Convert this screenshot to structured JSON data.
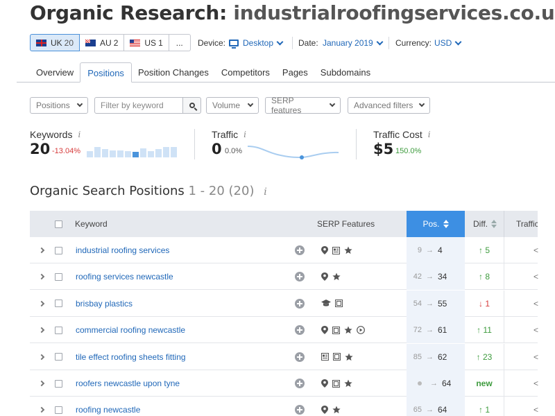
{
  "page": {
    "title_prefix": "Organic Research:",
    "title_domain": "industrialroofingservices.co.uk"
  },
  "databases": [
    {
      "code": "UK",
      "count": "20",
      "flag": "uk",
      "active": true
    },
    {
      "code": "AU",
      "count": "2",
      "flag": "au",
      "active": false
    },
    {
      "code": "US",
      "count": "1",
      "flag": "us",
      "active": false
    }
  ],
  "more_label": "...",
  "device": {
    "label": "Device:",
    "value": "Desktop"
  },
  "date": {
    "label": "Date:",
    "value": "January 2019"
  },
  "currency": {
    "label": "Currency:",
    "value": "USD"
  },
  "tabs": [
    "Overview",
    "Positions",
    "Position Changes",
    "Competitors",
    "Pages",
    "Subdomains"
  ],
  "active_tab": "Positions",
  "filters": {
    "positions": "Positions",
    "keyword_placeholder": "Filter by keyword",
    "volume": "Volume",
    "serp": "SERP features",
    "advanced": "Advanced filters"
  },
  "summary": {
    "keywords": {
      "label": "Keywords",
      "value": "20",
      "change": "-13.04%"
    },
    "traffic": {
      "label": "Traffic",
      "value": "0",
      "change": "0.0%"
    },
    "traffic_cost": {
      "label": "Traffic Cost",
      "value": "$5",
      "change": "150.0%"
    },
    "keywords_trend": [
      0.55,
      0.95,
      0.75,
      0.6,
      0.65,
      0.55,
      0.5,
      0.8,
      0.55,
      0.75,
      0.95,
      0.95
    ],
    "keywords_trend_highlight": 6
  },
  "section": {
    "title": "Organic Search Positions",
    "range": "1 - 20 (20)"
  },
  "table": {
    "columns": {
      "keyword": "Keyword",
      "serp": "SERP Features",
      "pos": "Pos.",
      "diff": "Diff.",
      "traffic": "Traffic"
    },
    "rows": [
      {
        "keyword": "industrial roofing services",
        "serp": [
          "pin-icon",
          "document-icon",
          "star-icon"
        ],
        "prev": "9",
        "pos": "4",
        "diff": "↑ 5",
        "diff_type": "up"
      },
      {
        "keyword": "roofing services newcastle",
        "serp": [
          "pin-icon",
          "star-icon"
        ],
        "prev": "42",
        "pos": "34",
        "diff": "↑ 8",
        "diff_type": "up"
      },
      {
        "keyword": "brisbay plastics",
        "serp": [
          "graduation-cap-icon",
          "image-icon"
        ],
        "prev": "54",
        "pos": "55",
        "diff": "↓ 1",
        "diff_type": "down"
      },
      {
        "keyword": "commercial roofing newcastle",
        "serp": [
          "pin-icon",
          "image-icon",
          "star-icon",
          "play-icon"
        ],
        "prev": "72",
        "pos": "61",
        "diff": "↑ 11",
        "diff_type": "up"
      },
      {
        "keyword": "tile effect roofing sheets fitting",
        "serp": [
          "document-icon",
          "image-icon",
          "star-icon"
        ],
        "prev": "85",
        "pos": "62",
        "diff": "↑ 23",
        "diff_type": "up"
      },
      {
        "keyword": "roofers newcastle upon tyne",
        "serp": [
          "pin-icon",
          "image-icon",
          "star-icon"
        ],
        "prev": "",
        "pos": "64",
        "diff": "new",
        "diff_type": "new"
      },
      {
        "keyword": "roofing newcastle",
        "serp": [
          "pin-icon",
          "star-icon"
        ],
        "prev": "65",
        "pos": "64",
        "diff": "↑ 1",
        "diff_type": "up"
      }
    ]
  },
  "colors": {
    "accent": "#1f67b8",
    "pos_header": "#3d8fe3",
    "up": "#3d9b3d",
    "down": "#d63b3b"
  }
}
